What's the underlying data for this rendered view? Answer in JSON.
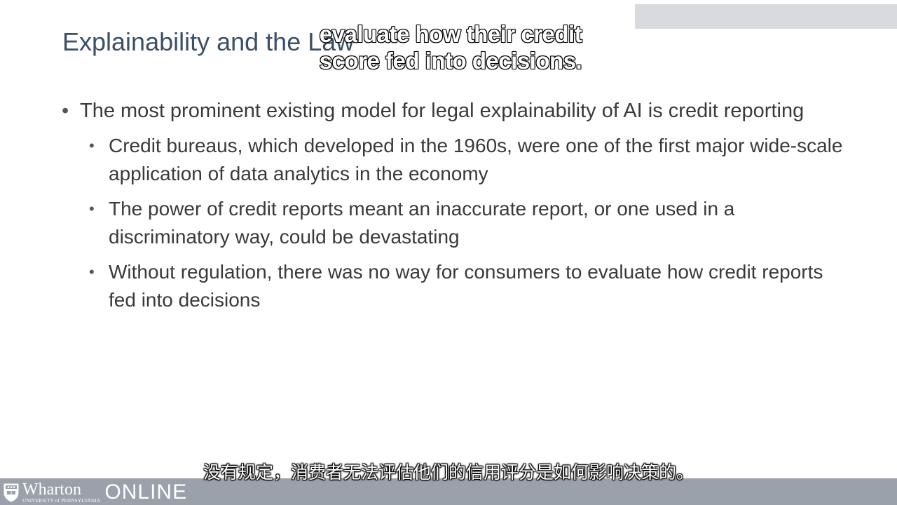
{
  "slide": {
    "title": "Explainability and the Law",
    "bullets": [
      {
        "level": 1,
        "text": "The most prominent existing model for legal explainability of AI is credit reporting"
      },
      {
        "level": 2,
        "text": "Credit bureaus, which developed in the 1960s, were one of the first major wide-scale application of data analytics in the economy"
      },
      {
        "level": 2,
        "text": "The power of credit reports meant an inaccurate report, or one used in a discriminatory way, could be devastating"
      },
      {
        "level": 2,
        "text": "Without regulation, there was no way for consumers to evaluate how credit reports fed into decisions"
      }
    ],
    "bullet_glyph": "•"
  },
  "captions": {
    "english_line1": "evaluate how their credit",
    "english_line2": "score fed into decisions.",
    "chinese": "没有规定，消费者无法评估他们的信用评分是如何影响决策的。"
  },
  "branding": {
    "brand": "Wharton",
    "subtitle": "UNIVERSITY of PENNSYLVANIA",
    "online": "ONLINE",
    "shield_icon": "penn-shield-icon"
  },
  "colors": {
    "title": "#3b4f66",
    "body_text": "#3a3a3a",
    "top_bar": "#d9dadd",
    "bottom_bar": "#9ba1aa"
  }
}
